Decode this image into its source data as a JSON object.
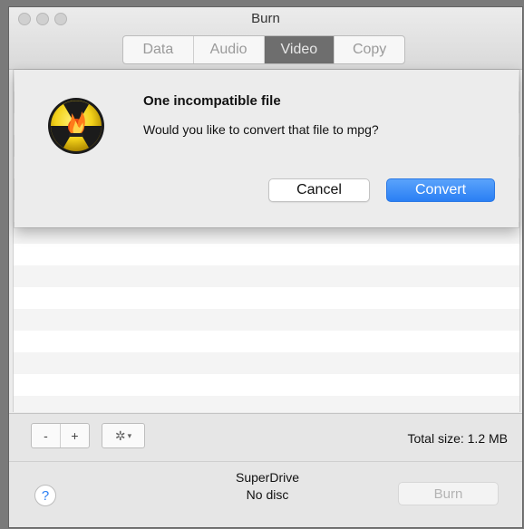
{
  "window": {
    "title": "Burn",
    "tabs": [
      {
        "label": "Data",
        "active": false
      },
      {
        "label": "Audio",
        "active": false
      },
      {
        "label": "Video",
        "active": true
      },
      {
        "label": "Copy",
        "active": false
      }
    ]
  },
  "alert": {
    "icon": "burn-radioactive-flame-icon",
    "title": "One incompatible file",
    "message": "Would you like to convert that file to mpg?",
    "cancel_label": "Cancel",
    "convert_label": "Convert"
  },
  "toolbar": {
    "remove_label": "-",
    "add_label": "+",
    "gear_icon": "gear-icon",
    "gear_glyph": "✲",
    "caret_glyph": "▾",
    "total_size": "Total size: 1.2 MB"
  },
  "footer": {
    "help_label": "?",
    "drive_name": "SuperDrive",
    "drive_status": "No disc",
    "burn_label": "Burn"
  },
  "colors": {
    "accent": "#2a7ff4",
    "active_tab": "#6e6e6e",
    "icon_yellow": "#f3d21a",
    "icon_black": "#1b1b1b"
  }
}
